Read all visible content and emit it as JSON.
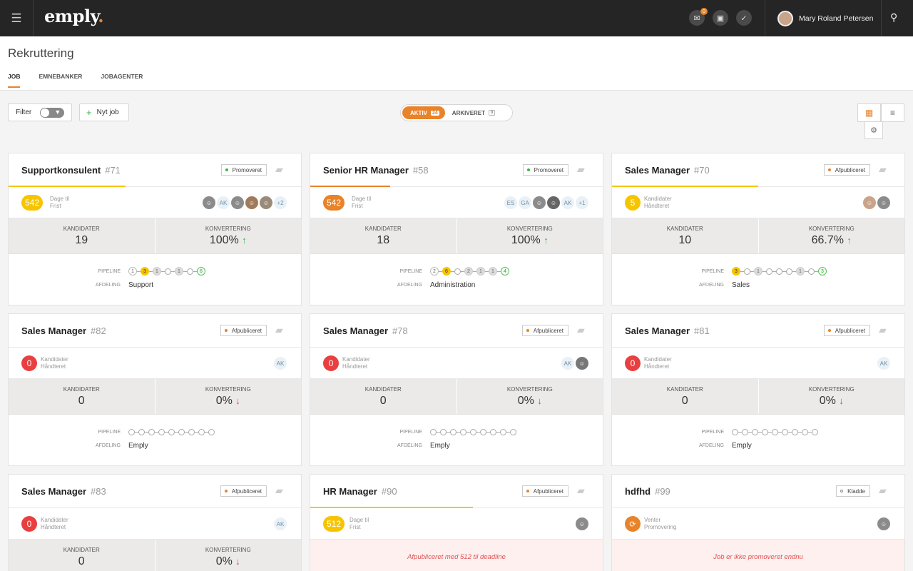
{
  "app": {
    "logo": "emply",
    "logo_dot": ".",
    "notif_count": "0",
    "user_name": "Mary Roland Petersen"
  },
  "page": {
    "title": "Rekruttering",
    "tabs": [
      "JOB",
      "EMNEBANKER",
      "JOBAGENTER"
    ]
  },
  "toolbar": {
    "filter_label": "Filter",
    "new_job_label": "Nyt job",
    "aktiv_label": "AKTIV",
    "aktiv_count": "24",
    "arkiveret_label": "ARKIVERET",
    "arkiveret_count": "0"
  },
  "labels": {
    "kandidater": "KANDIDATER",
    "konvertering": "KONVERTERING",
    "pipeline": "PIPELINE",
    "afdeling": "AFDELING"
  },
  "colors": {
    "accent": "#e8832a",
    "yellow": "#f6c500",
    "red": "#e84040",
    "green": "#3bb54a"
  },
  "cards": [
    {
      "title": "Supportkonsulent",
      "num": "#71",
      "status": "Promoveret",
      "badge": "542",
      "info1": "Dage til",
      "info2": "Frist",
      "kandidater": "19",
      "konvertering": "100%",
      "dept": "Support"
    },
    {
      "title": "Senior HR Manager",
      "num": "#58",
      "status": "Promoveret",
      "badge": "542",
      "info1": "Dage til",
      "info2": "Frist",
      "kandidater": "18",
      "konvertering": "100%",
      "dept": "Administration"
    },
    {
      "title": "Sales Manager",
      "num": "#70",
      "status": "Afpubliceret",
      "badge": "5",
      "info1": "Kandidater",
      "info2": "Håndteret",
      "kandidater": "10",
      "konvertering": "66.7%",
      "dept": "Sales"
    },
    {
      "title": "Sales Manager",
      "num": "#82",
      "status": "Afpubliceret",
      "badge": "0",
      "info1": "Kandidater",
      "info2": "Håndteret",
      "kandidater": "0",
      "konvertering": "0%",
      "dept": "Emply"
    },
    {
      "title": "Sales Manager",
      "num": "#78",
      "status": "Afpubliceret",
      "badge": "0",
      "info1": "Kandidater",
      "info2": "Håndteret",
      "kandidater": "0",
      "konvertering": "0%",
      "dept": "Emply"
    },
    {
      "title": "Sales Manager",
      "num": "#81",
      "status": "Afpubliceret",
      "badge": "0",
      "info1": "Kandidater",
      "info2": "Håndteret",
      "kandidater": "0",
      "konvertering": "0%",
      "dept": "Emply"
    },
    {
      "title": "Sales Manager",
      "num": "#83",
      "status": "Afpubliceret",
      "badge": "0",
      "info1": "Kandidater",
      "info2": "Håndteret",
      "kandidater": "0",
      "konvertering": "0%"
    },
    {
      "title": "HR Manager",
      "num": "#90",
      "status": "Afpubliceret",
      "badge": "512",
      "info1": "Dage til",
      "info2": "Frist",
      "message": "Afpubliceret med 512 til deadline"
    },
    {
      "title": "hdfhd",
      "num": "#99",
      "status": "Kladde",
      "info1": "Venter",
      "info2": "Promovering",
      "message": "Job er ikke promoveret endnu"
    }
  ],
  "avatar_initials": {
    "ak": "AK",
    "es": "ES",
    "ga": "GA",
    "plus2": "+2",
    "plus1": "+1"
  },
  "pipeline_values": {
    "c71": [
      "1",
      "3",
      "1",
      "1",
      "6"
    ],
    "c58": [
      "2",
      "6",
      "2",
      "1",
      "1",
      "4"
    ],
    "c70": [
      "3",
      "1",
      "1",
      "3"
    ]
  }
}
